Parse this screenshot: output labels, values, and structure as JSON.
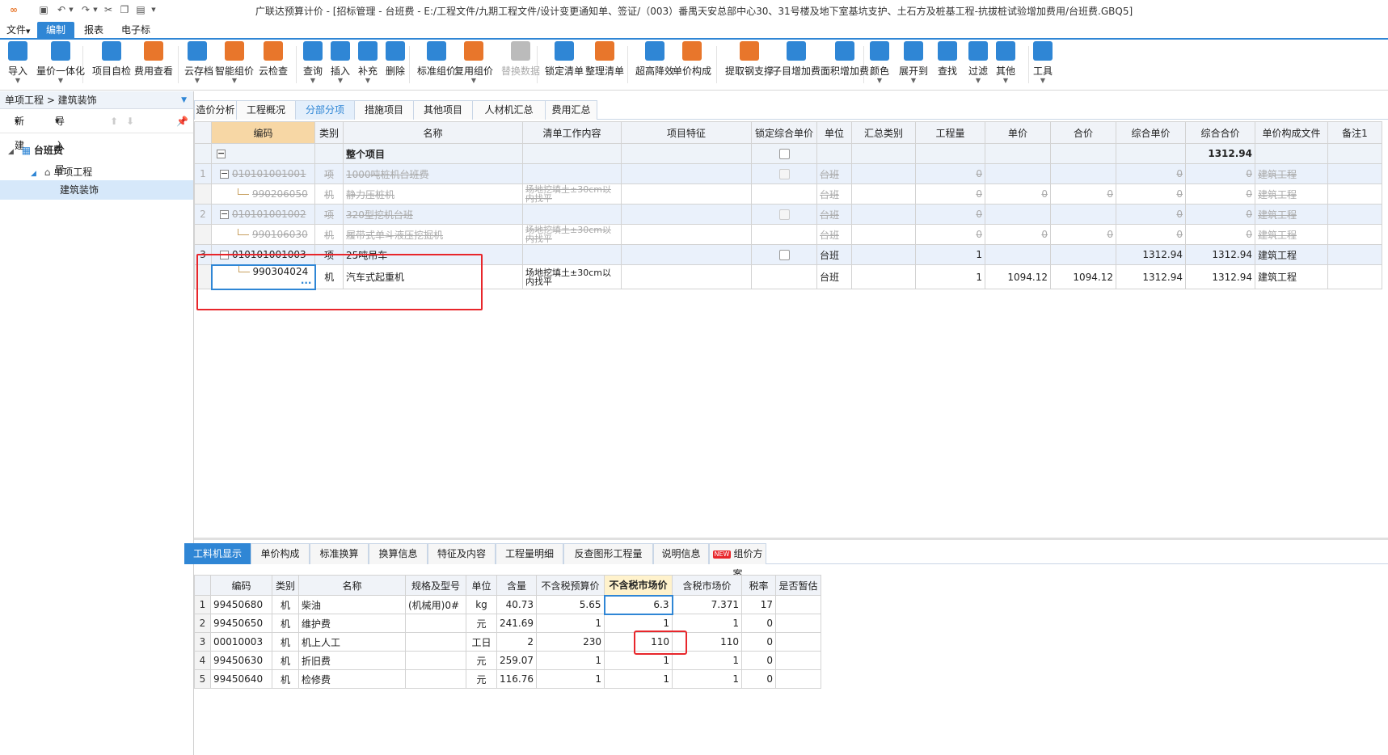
{
  "app": {
    "title": "广联达预算计价 - [招标管理 - 台班费 - E:/工程文件/九期工程文件/设计变更通知单、签证/（003）番禺天安总部中心30、31号楼及地下室基坑支护、土石方及桩基工程-抗拔桩试验增加费用/台班费.GBQ5]"
  },
  "menu": [
    "文件",
    "编制",
    "报表",
    "电子标"
  ],
  "ribbon": [
    {
      "label": "导入",
      "icon": "import-icon",
      "color": "#2f86d5",
      "arrow": true
    },
    {
      "label": "量价一体化",
      "icon": "quantity-price-icon",
      "color": "#2f86d5",
      "arrow": true
    },
    {
      "label": "项目自检",
      "icon": "self-check-icon",
      "color": "#2f86d5",
      "arrow": false
    },
    {
      "label": "费用查看",
      "icon": "cost-view-icon",
      "color": "#e8762b",
      "arrow": false
    },
    {
      "label": "云存档",
      "icon": "cloud-save-icon",
      "color": "#2f86d5",
      "arrow": true
    },
    {
      "label": "智能组价",
      "icon": "smart-price-icon",
      "color": "#e8762b",
      "arrow": true
    },
    {
      "label": "云检查",
      "icon": "cloud-check-icon",
      "color": "#e8762b",
      "arrow": false
    },
    {
      "label": "查询",
      "icon": "query-icon",
      "color": "#2f86d5",
      "arrow": true
    },
    {
      "label": "插入",
      "icon": "insert-icon",
      "color": "#2f86d5",
      "arrow": true
    },
    {
      "label": "补充",
      "icon": "supplement-icon",
      "color": "#2f86d5",
      "arrow": true
    },
    {
      "label": "删除",
      "icon": "delete-icon",
      "color": "#2f86d5",
      "arrow": false
    },
    {
      "label": "标准组价",
      "icon": "standard-price-icon",
      "color": "#2f86d5",
      "arrow": false
    },
    {
      "label": "复用组价",
      "icon": "reuse-price-icon",
      "color": "#e8762b",
      "arrow": true
    },
    {
      "label": "替换数据",
      "icon": "replace-data-icon",
      "color": "#bbbbbb",
      "arrow": false,
      "disabled": true
    },
    {
      "label": "锁定清单",
      "icon": "lock-list-icon",
      "color": "#2f86d5",
      "arrow": false
    },
    {
      "label": "整理清单",
      "icon": "organize-list-icon",
      "color": "#e8762b",
      "arrow": false
    },
    {
      "label": "超高降效",
      "icon": "height-efficiency-icon",
      "color": "#2f86d5",
      "arrow": false
    },
    {
      "label": "单价构成",
      "icon": "unit-price-icon",
      "color": "#e8762b",
      "arrow": false
    },
    {
      "label": "提取钢支撑",
      "icon": "steel-support-icon",
      "color": "#e8762b",
      "arrow": false
    },
    {
      "label": "子目增加费",
      "icon": "sub-item-fee-icon",
      "color": "#2f86d5",
      "arrow": false
    },
    {
      "label": "面积增加费",
      "icon": "area-fee-icon",
      "color": "#2f86d5",
      "arrow": false
    },
    {
      "label": "颜色",
      "icon": "color-icon",
      "color": "#2f86d5",
      "arrow": true
    },
    {
      "label": "展开到",
      "icon": "expand-to-icon",
      "color": "#2f86d5",
      "arrow": true
    },
    {
      "label": "查找",
      "icon": "find-icon",
      "color": "#2f86d5",
      "arrow": false
    },
    {
      "label": "过滤",
      "icon": "filter-icon",
      "color": "#2f86d5",
      "arrow": true
    },
    {
      "label": "其他",
      "icon": "other-icon",
      "color": "#2f86d5",
      "arrow": true
    },
    {
      "label": "工具",
      "icon": "tools-icon",
      "color": "#2f86d5",
      "arrow": true
    }
  ],
  "left": {
    "breadcrumb": "单项工程 > 建筑装饰",
    "new_btn": "新建",
    "io_btn": "导入导出",
    "tree_root": "台班费",
    "tree_child": "单项工程",
    "tree_leaf": "建筑装饰"
  },
  "main_tabs": [
    "造价分析",
    "工程概况",
    "分部分项",
    "措施项目",
    "其他项目",
    "人材机汇总",
    "费用汇总"
  ],
  "top_grid": {
    "headers": [
      "编码",
      "类别",
      "名称",
      "清单工作内容",
      "项目特征",
      "锁定综合单价",
      "单位",
      "汇总类别",
      "工程量",
      "单价",
      "合价",
      "综合单价",
      "综合合价",
      "单价构成文件",
      "备注1"
    ],
    "rows": [
      {
        "num": "",
        "code": "",
        "type": "",
        "name": "整个项目",
        "work": "",
        "feature": "",
        "lock": true,
        "unit": "",
        "cat": "",
        "qty": "",
        "price": "",
        "total": "",
        "uprice": "",
        "utotal": "1312.94",
        "file": "",
        "note": "",
        "style": "hdr",
        "level": 0,
        "box": "−"
      },
      {
        "num": "1",
        "code": "010101001001",
        "type": "项",
        "name": "1000吨桩机台班费",
        "work": "",
        "feature": "",
        "lock": true,
        "unit": "台班",
        "cat": "",
        "qty": "0",
        "price": "",
        "total": "",
        "uprice": "0",
        "utotal": "0",
        "file": "建筑工程",
        "note": "",
        "style": "grey-blue",
        "level": 1,
        "box": "−"
      },
      {
        "num": "",
        "code": "990206050",
        "type": "机",
        "name": "静力压桩机",
        "work": "场地挖填土±30cm以内找平",
        "feature": "",
        "lock": false,
        "unit": "台班",
        "cat": "",
        "qty": "0",
        "price": "0",
        "total": "0",
        "uprice": "0",
        "utotal": "0",
        "file": "建筑工程",
        "note": "",
        "style": "grey",
        "level": 2,
        "box": ""
      },
      {
        "num": "2",
        "code": "010101001002",
        "type": "项",
        "name": "320型挖机台班",
        "work": "",
        "feature": "",
        "lock": true,
        "unit": "台班",
        "cat": "",
        "qty": "0",
        "price": "",
        "total": "",
        "uprice": "0",
        "utotal": "0",
        "file": "建筑工程",
        "note": "",
        "style": "grey-blue",
        "level": 1,
        "box": "−"
      },
      {
        "num": "",
        "code": "990106030",
        "type": "机",
        "name": "履带式单斗液压挖掘机",
        "work": "场地挖填土±30cm以内找平",
        "feature": "",
        "lock": false,
        "unit": "台班",
        "cat": "",
        "qty": "0",
        "price": "0",
        "total": "0",
        "uprice": "0",
        "utotal": "0",
        "file": "建筑工程",
        "note": "",
        "style": "grey",
        "level": 2,
        "box": ""
      },
      {
        "num": "3",
        "code": "010101001003",
        "type": "项",
        "name": "25吨吊车",
        "work": "",
        "feature": "",
        "lock": true,
        "unit": "台班",
        "cat": "",
        "qty": "1",
        "price": "",
        "total": "",
        "uprice": "1312.94",
        "utotal": "1312.94",
        "file": "建筑工程",
        "note": "",
        "style": "blue",
        "level": 1,
        "box": "−"
      },
      {
        "num": "",
        "code": "990304024",
        "type": "机",
        "name": "汽车式起重机",
        "work": "场地挖填土±30cm以内找平",
        "feature": "",
        "lock": false,
        "unit": "台班",
        "cat": "",
        "qty": "1",
        "price": "1094.12",
        "total": "1094.12",
        "uprice": "1312.94",
        "utotal": "1312.94",
        "file": "建筑工程",
        "note": "",
        "style": "sel",
        "level": 2,
        "box": ""
      }
    ]
  },
  "bottom_tabs": [
    "工料机显示",
    "单价构成",
    "标准换算",
    "换算信息",
    "特征及内容",
    "工程量明细",
    "反查图形工程量",
    "说明信息",
    "组价方案"
  ],
  "new_tag": "NEW",
  "bottom_grid": {
    "headers": [
      "编码",
      "类别",
      "名称",
      "规格及型号",
      "单位",
      "含量",
      "不含税预算价",
      "不含税市场价",
      "含税市场价",
      "税率",
      "是否暂估"
    ],
    "rows": [
      {
        "num": "1",
        "code": "99450680",
        "type": "机",
        "name": "柴油",
        "spec": "(机械用)0#",
        "unit": "kg",
        "amt": "40.73",
        "budget": "5.65",
        "market": "6.3",
        "taxmarket": "7.371",
        "rate": "17",
        "est": ""
      },
      {
        "num": "2",
        "code": "99450650",
        "type": "机",
        "name": "维护费",
        "spec": "",
        "unit": "元",
        "amt": "241.69",
        "budget": "1",
        "market": "1",
        "taxmarket": "1",
        "rate": "0",
        "est": ""
      },
      {
        "num": "3",
        "code": "00010003",
        "type": "机",
        "name": "机上人工",
        "spec": "",
        "unit": "工日",
        "amt": "2",
        "budget": "230",
        "market": "110",
        "taxmarket": "110",
        "rate": "0",
        "est": ""
      },
      {
        "num": "4",
        "code": "99450630",
        "type": "机",
        "name": "折旧费",
        "spec": "",
        "unit": "元",
        "amt": "259.07",
        "budget": "1",
        "market": "1",
        "taxmarket": "1",
        "rate": "0",
        "est": ""
      },
      {
        "num": "5",
        "code": "99450640",
        "type": "机",
        "name": "检修费",
        "spec": "",
        "unit": "元",
        "amt": "116.76",
        "budget": "1",
        "market": "1",
        "taxmarket": "1",
        "rate": "0",
        "est": ""
      }
    ]
  }
}
